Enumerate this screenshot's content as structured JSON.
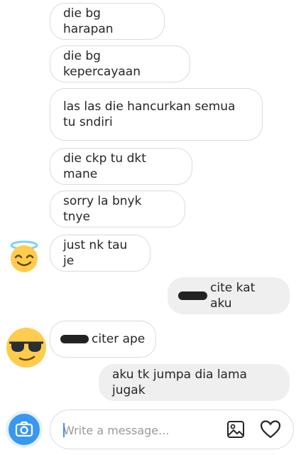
{
  "messages": [
    {
      "side": "in",
      "text": "die bg harapan"
    },
    {
      "side": "in",
      "text": "die bg kepercayaan"
    },
    {
      "side": "in",
      "text": "las las die hancurkan semua tu sndiri"
    },
    {
      "side": "in",
      "text": "die ckp tu dkt mane"
    },
    {
      "side": "in",
      "text": "sorry la bnyk tnye"
    },
    {
      "side": "in",
      "text": "just nk tau je",
      "avatar": "angel-emoji"
    },
    {
      "side": "out",
      "text": "cite kat aku",
      "redacted_prefix": true
    },
    {
      "side": "in",
      "text": "citer ape",
      "redacted_prefix": true,
      "avatar": "sunglasses-emoji"
    },
    {
      "side": "out",
      "text": "aku tk jumpa dia lama jugak"
    }
  ],
  "composer": {
    "placeholder": "Write a message...",
    "icons": [
      "camera-icon",
      "image-icon",
      "heart-icon"
    ]
  },
  "colors": {
    "accent": "#3897f0",
    "incoming_border": "#dbdbdb",
    "outgoing_bg": "#efefef"
  }
}
